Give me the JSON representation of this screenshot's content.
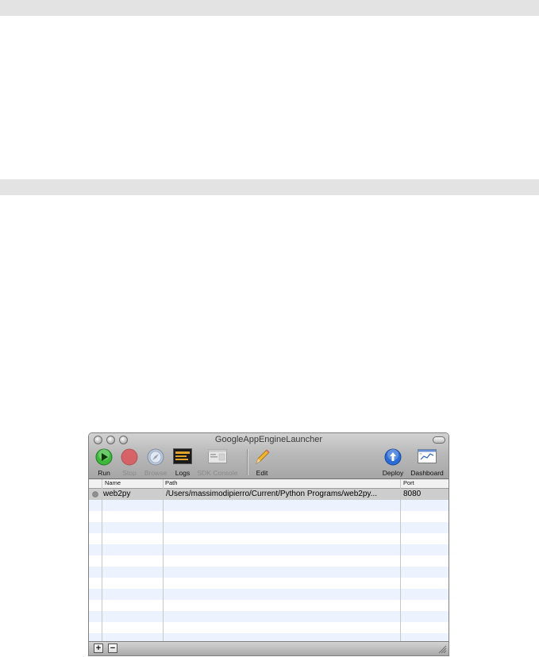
{
  "window": {
    "title": "GoogleAppEngineLauncher"
  },
  "toolbar": {
    "run": "Run",
    "stop": "Stop",
    "browse": "Browse",
    "logs": "Logs",
    "sdk_console": "SDK Console",
    "edit": "Edit",
    "deploy": "Deploy",
    "dashboard": "Dashboard"
  },
  "table": {
    "columns": [
      "Name",
      "Path",
      "Port"
    ],
    "rows": [
      {
        "status": "gray-dot",
        "name": "web2py",
        "path": "/Users/massimodipierro/Current/Python Programs/web2py...",
        "port": "8080"
      }
    ]
  },
  "footer": {
    "add": "+",
    "remove": "−"
  },
  "colors": {
    "run_green": "#3db83a",
    "stop_red": "#e0474c",
    "deploy_blue": "#2a6bd6",
    "row_alt": "#edf3fe",
    "row_selected": "#cdcdcd"
  }
}
